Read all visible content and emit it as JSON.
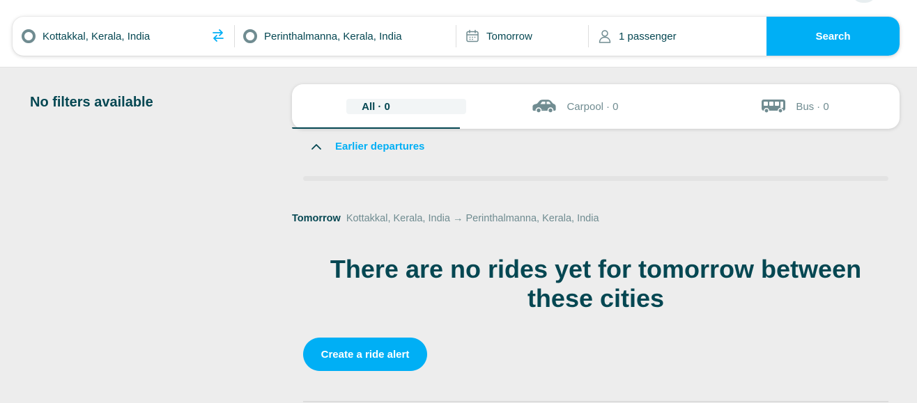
{
  "search": {
    "from": "Kottakkal, Kerala, India",
    "to": "Perinthalmanna, Kerala, India",
    "date": "Tomorrow",
    "passengers": "1 passenger",
    "button_label": "Search"
  },
  "filters": {
    "title": "No filters available"
  },
  "tabs": [
    {
      "label": "All",
      "count": "· 0",
      "icon": "none"
    },
    {
      "label": "Carpool",
      "count": "· 0",
      "icon": "car-icon"
    },
    {
      "label": "Bus",
      "count": "· 0",
      "icon": "bus-icon"
    }
  ],
  "results": {
    "earlier_label": "Earlier departures",
    "day": "Tomorrow",
    "route": "Kottakkal, Kerala, India → Perinthalmanna, Kerala, India",
    "empty_message": "There are no rides yet for tomorrow between these cities",
    "alert_button": "Create a ride alert"
  },
  "colors": {
    "accent": "#00aff5",
    "text": "#054752",
    "muted": "#708c91",
    "background": "#ededed"
  }
}
